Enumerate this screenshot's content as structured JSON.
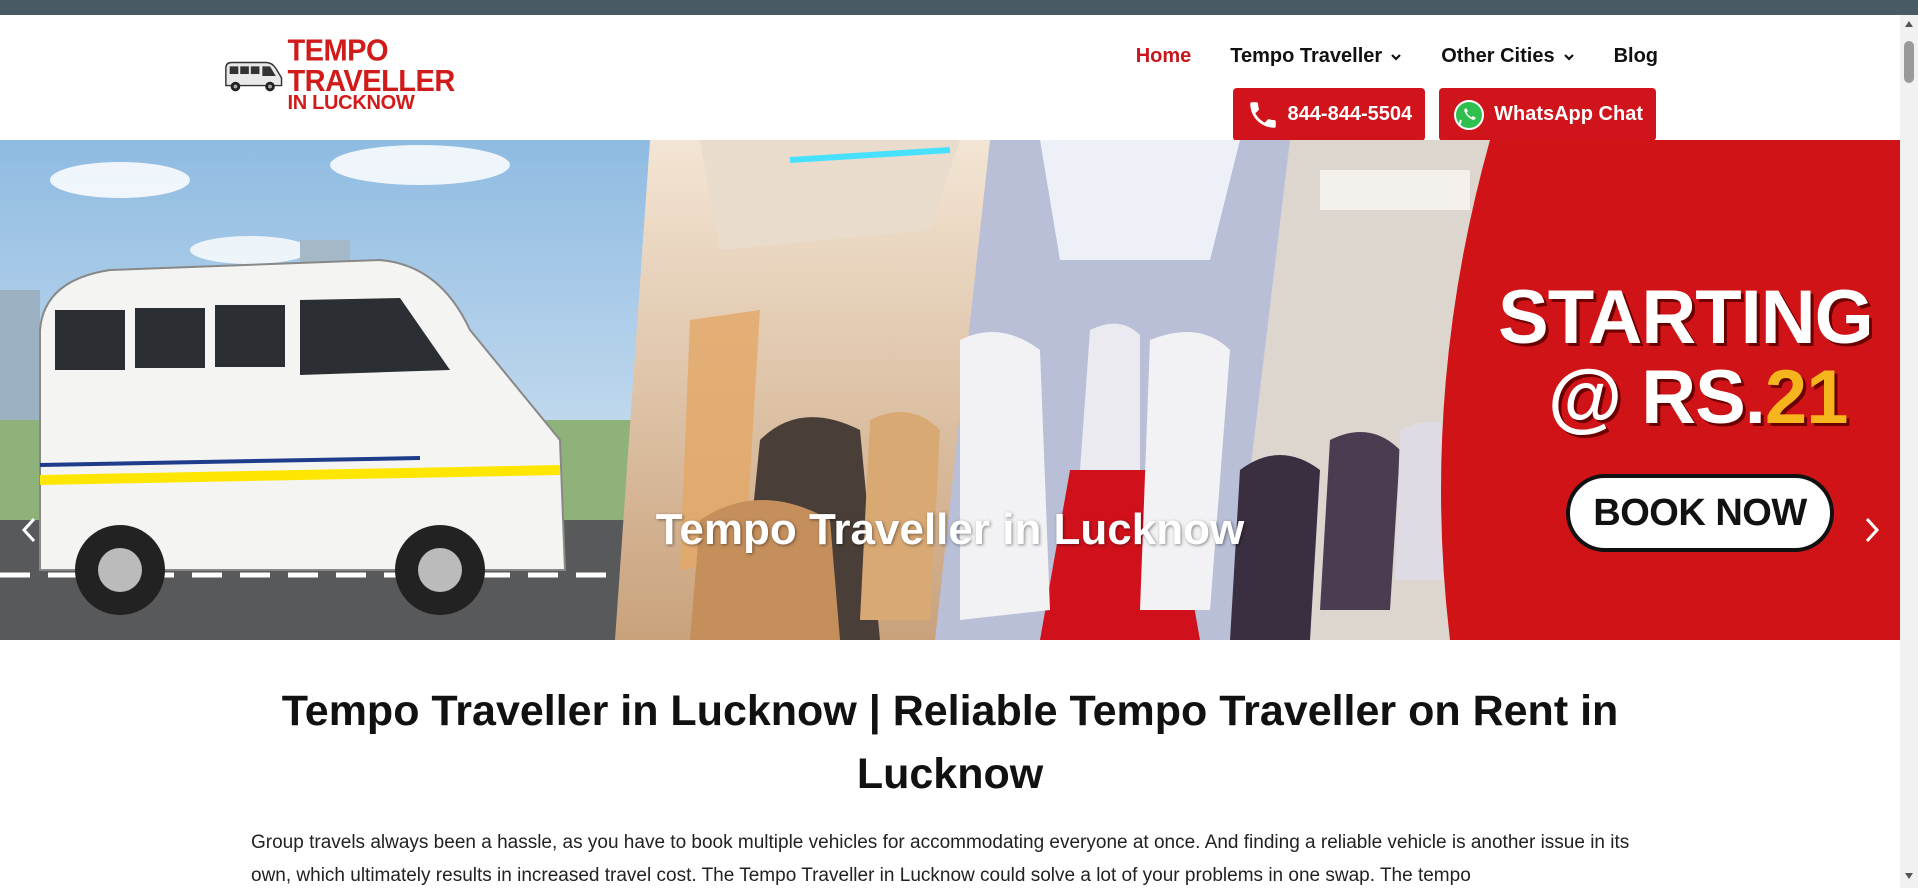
{
  "brand": {
    "line1": "TEMPO TRAVELLER",
    "line2": "IN LUCKNOW",
    "primary_color": "#d11b1b",
    "topbar_color": "#4a5a64"
  },
  "nav": {
    "items": [
      {
        "label": "Home",
        "active": true,
        "dropdown": false
      },
      {
        "label": "Tempo Traveller",
        "active": false,
        "dropdown": true
      },
      {
        "label": "Other Cities",
        "active": false,
        "dropdown": true
      },
      {
        "label": "Blog",
        "active": false,
        "dropdown": false
      }
    ]
  },
  "cta": {
    "phone_label": "844-844-5504",
    "phone_icon": "phone-icon",
    "whatsapp_label": "WhatsApp Chat",
    "whatsapp_icon": "whatsapp-icon"
  },
  "hero": {
    "title": "Tempo Traveller in Lucknow",
    "promo_line1": "STARTING",
    "promo_line2_prefix": "@ RS.",
    "promo_price": "21",
    "book_label": "BOOK NOW",
    "prev_icon": "chevron-left-icon",
    "next_icon": "chevron-right-icon",
    "slide_count": 3,
    "active_slide": 1
  },
  "main": {
    "heading": "Tempo Traveller in Lucknow | Reliable Tempo Traveller on Rent in Lucknow",
    "intro": "Group travels always been a hassle, as you have to book multiple vehicles for accommodating everyone at once. And finding a reliable vehicle is another issue in its own, which ultimately results in increased travel cost. The Tempo Traveller in Lucknow could solve a lot of your problems in one swap. The tempo"
  }
}
